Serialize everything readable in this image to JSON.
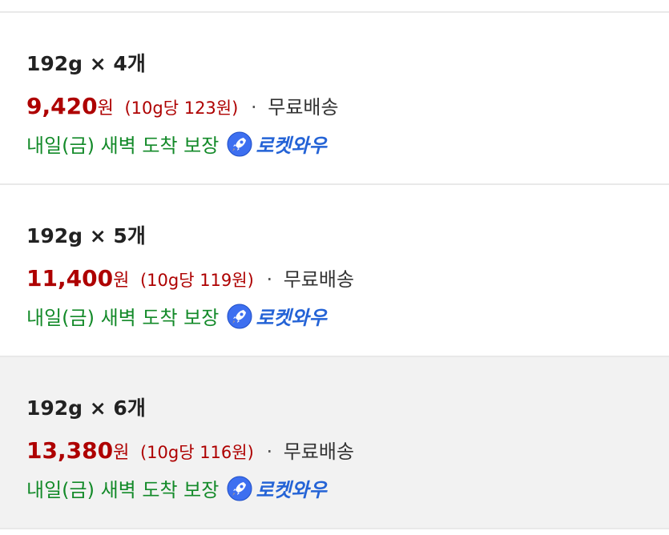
{
  "colors": {
    "price": "#ae0000",
    "delivery": "#138a29",
    "rocket_label": "#2463d6",
    "selected_background": "#f2f2f2"
  },
  "options": [
    {
      "title": "192g × 4개",
      "price": "9,420",
      "price_unit": "원",
      "unit_price": "(10g당 123원)",
      "separator": "·",
      "shipping": "무료배송",
      "delivery": "내일(금) 새벽 도착 보장",
      "rocket_icon": "rocket-icon",
      "rocket_label": "로켓와우",
      "selected": false
    },
    {
      "title": "192g × 5개",
      "price": "11,400",
      "price_unit": "원",
      "unit_price": "(10g당 119원)",
      "separator": "·",
      "shipping": "무료배송",
      "delivery": "내일(금) 새벽 도착 보장",
      "rocket_icon": "rocket-icon",
      "rocket_label": "로켓와우",
      "selected": false
    },
    {
      "title": "192g × 6개",
      "price": "13,380",
      "price_unit": "원",
      "unit_price": "(10g당 116원)",
      "separator": "·",
      "shipping": "무료배송",
      "delivery": "내일(금) 새벽 도착 보장",
      "rocket_icon": "rocket-icon",
      "rocket_label": "로켓와우",
      "selected": true
    }
  ]
}
